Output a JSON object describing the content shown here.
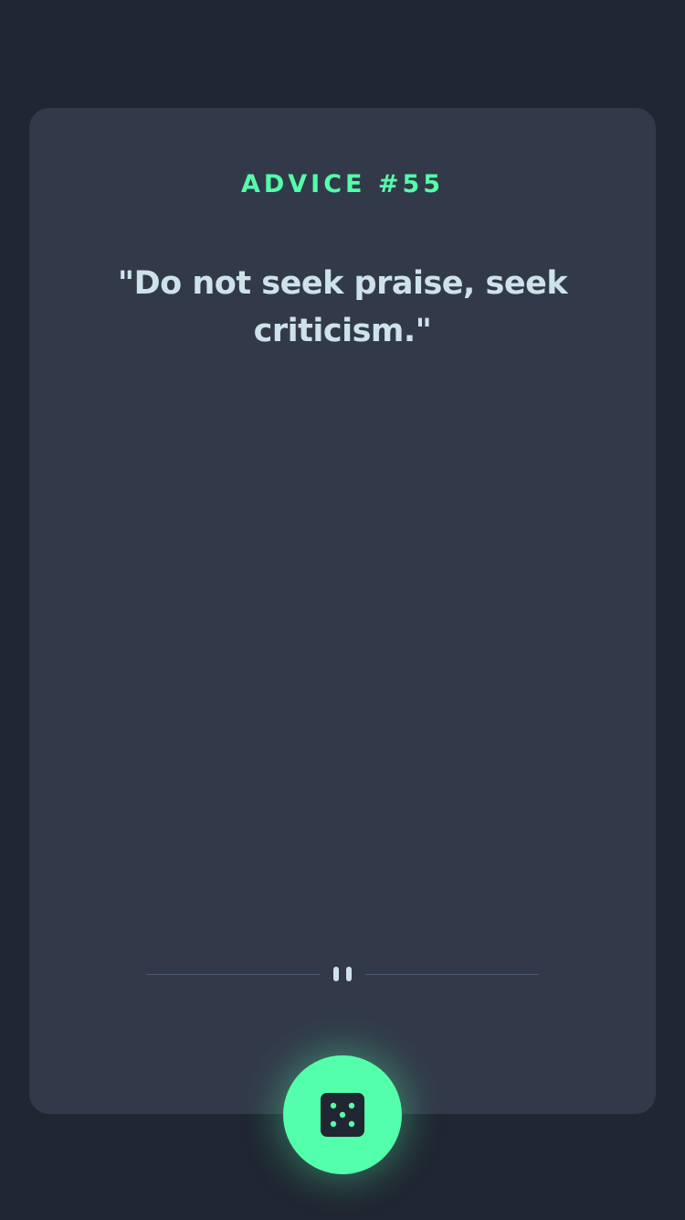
{
  "advice": {
    "title": "ADVICE #55",
    "quote": "\"Do not seek praise, seek criticism.\""
  },
  "icons": {
    "divider": "pause-icon",
    "button": "dice-icon"
  },
  "colors": {
    "background": "#202632",
    "card": "#323a49",
    "accent": "#53ffaa",
    "text": "#cee3e9",
    "divider": "#4f5d74"
  }
}
